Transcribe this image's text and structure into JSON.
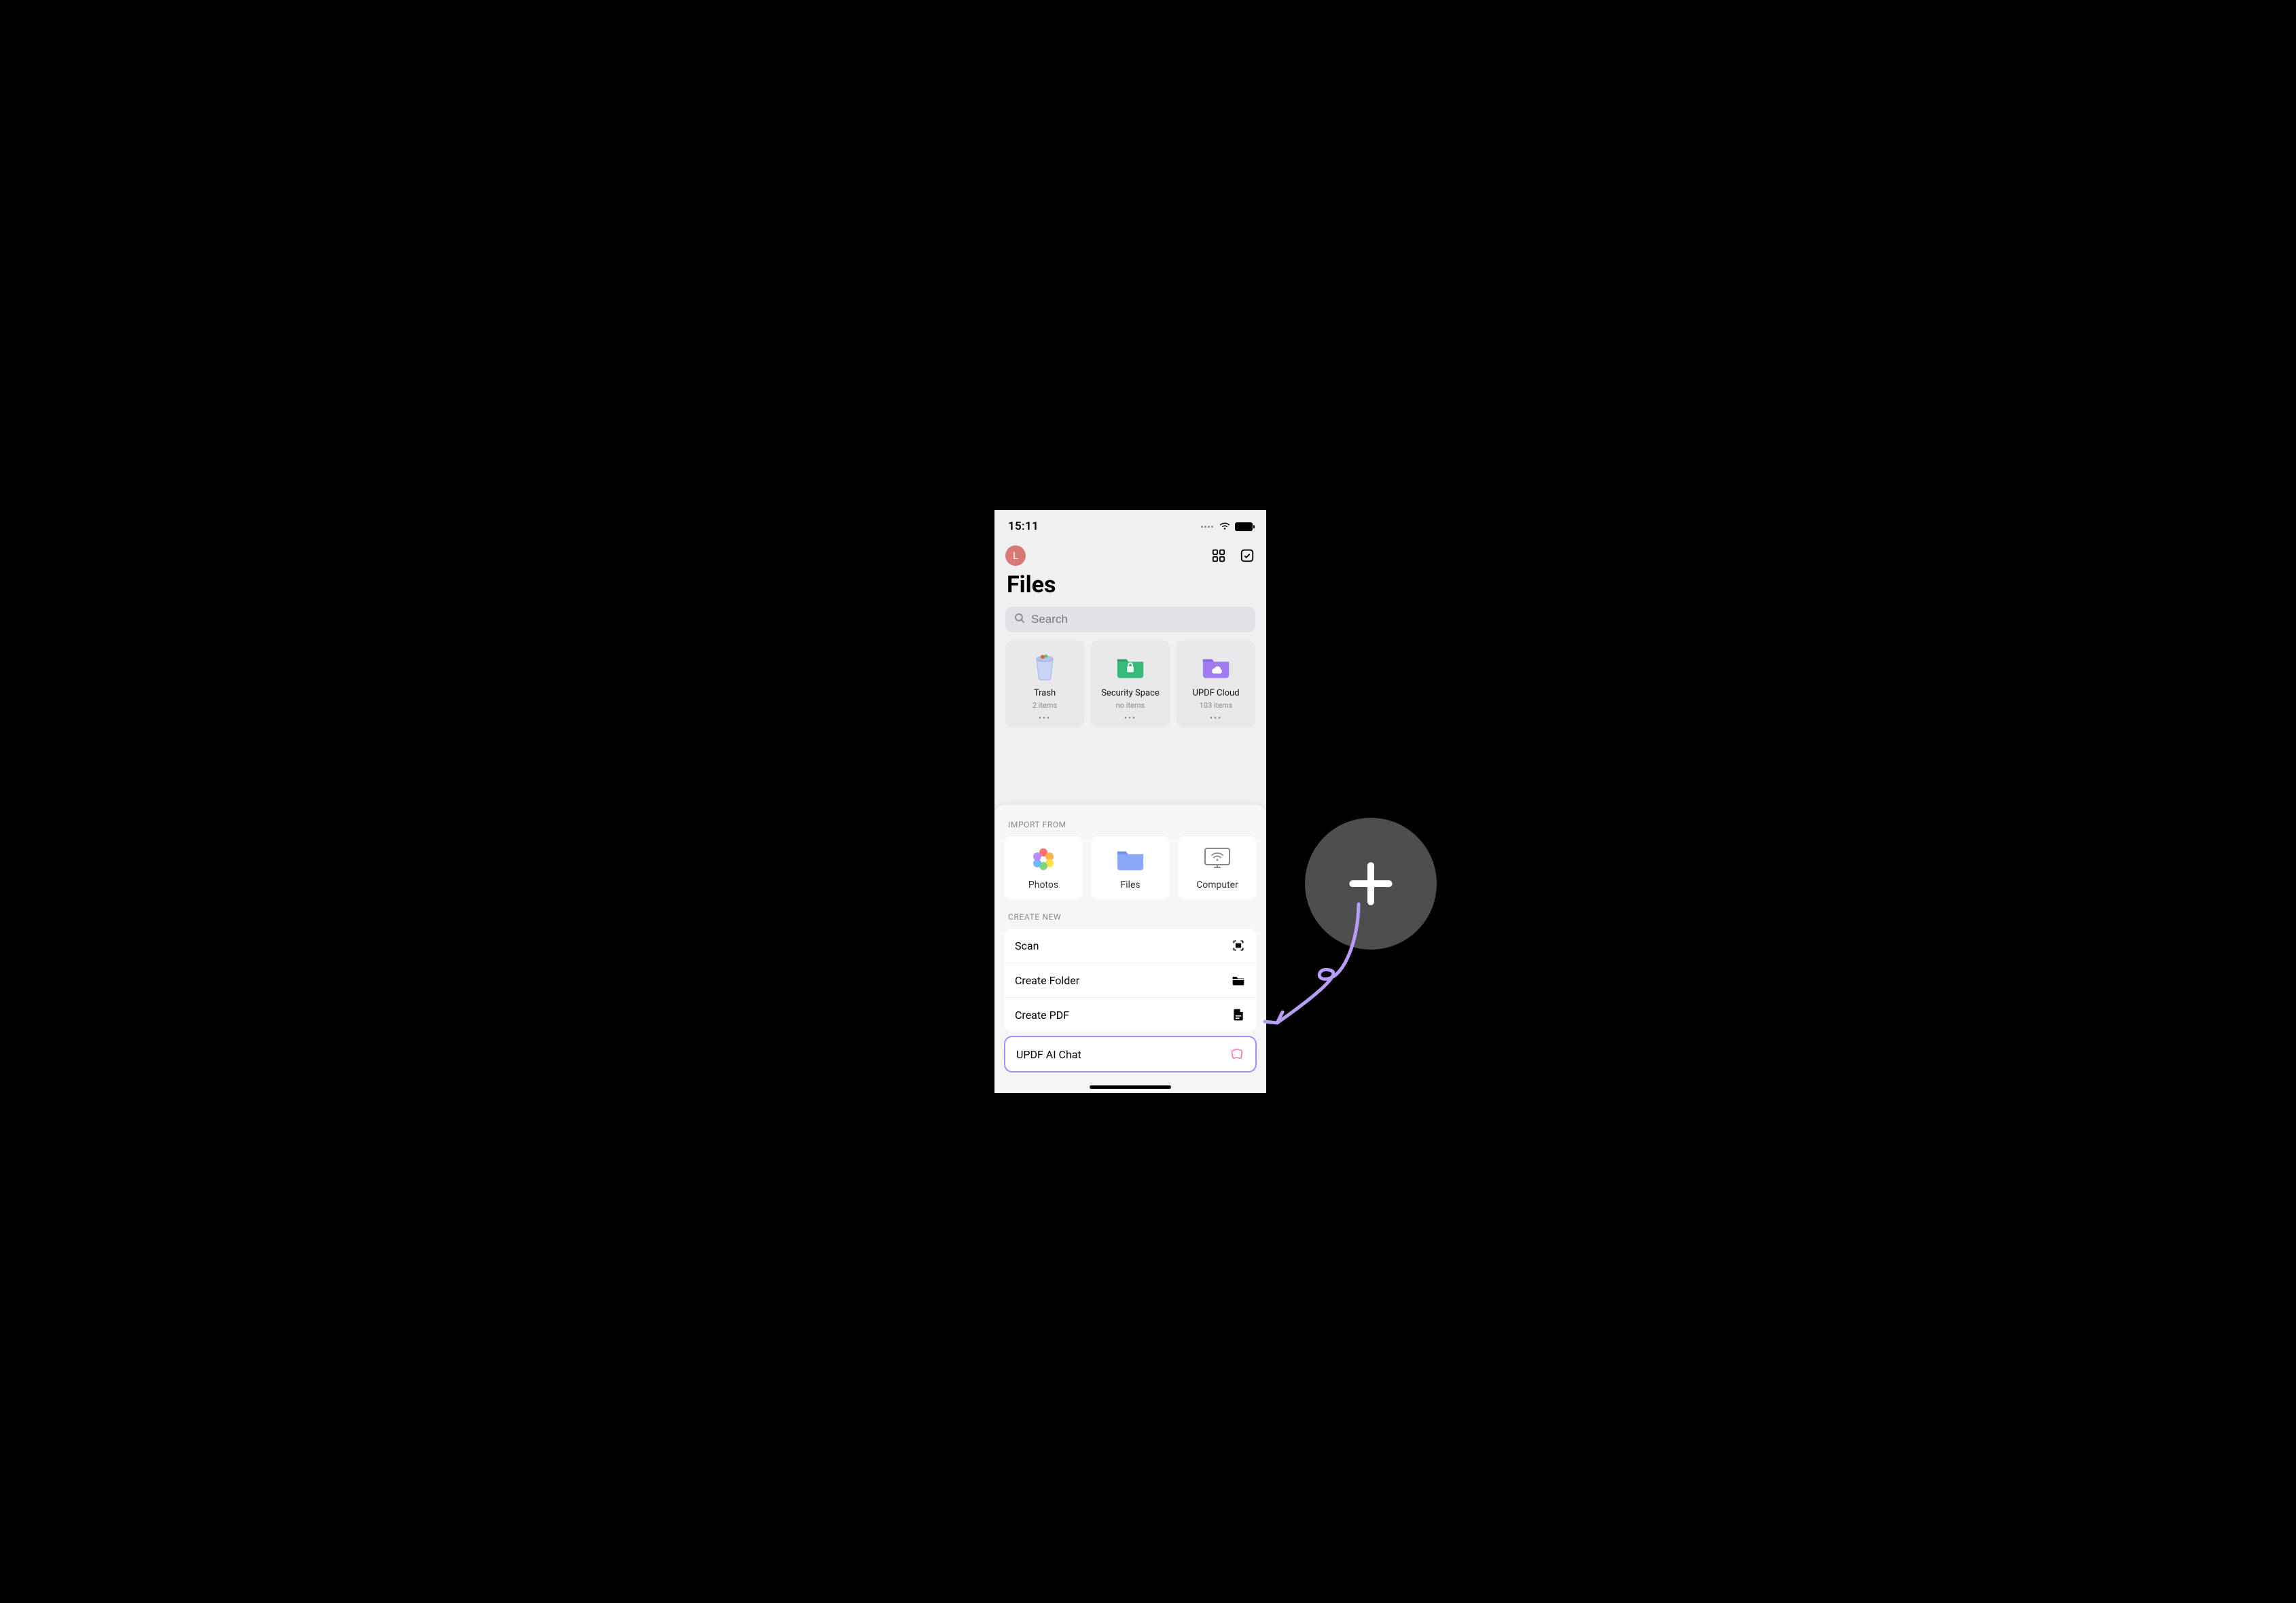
{
  "status": {
    "time": "15:11"
  },
  "avatar": {
    "initial": "L"
  },
  "page": {
    "title": "Files"
  },
  "search": {
    "placeholder": "Search"
  },
  "folders": [
    {
      "title": "Trash",
      "subtitle": "2 items",
      "icon": "trash"
    },
    {
      "title": "Security Space",
      "subtitle": "no items",
      "icon": "secure-folder"
    },
    {
      "title": "UPDF Cloud",
      "subtitle": "103 items",
      "icon": "cloud-folder"
    }
  ],
  "sheet": {
    "importLabel": "IMPORT FROM",
    "import": [
      {
        "label": "Photos",
        "icon": "photos"
      },
      {
        "label": "Files",
        "icon": "files"
      },
      {
        "label": "Computer",
        "icon": "computer"
      }
    ],
    "createLabel": "CREATE NEW",
    "create": [
      {
        "label": "Scan",
        "icon": "scan"
      },
      {
        "label": "Create Folder",
        "icon": "folder"
      },
      {
        "label": "Create PDF",
        "icon": "pdf"
      },
      {
        "label": "UPDF AI Chat",
        "icon": "ai-chat",
        "highlight": true
      }
    ]
  },
  "annotation": {
    "plusColor": "#4e4e4e",
    "arrowColor": "#b79df3"
  }
}
